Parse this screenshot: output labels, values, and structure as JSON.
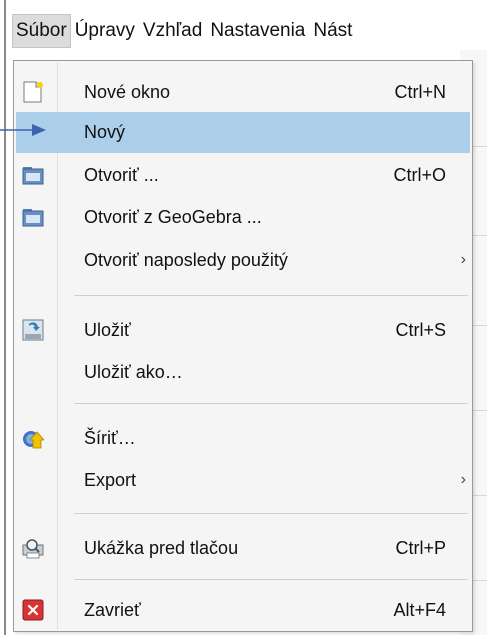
{
  "menubar": {
    "items": [
      {
        "label": "Súbor",
        "active": true
      },
      {
        "label": "Úpravy"
      },
      {
        "label": "Vzhľad"
      },
      {
        "label": "Nastavenia"
      },
      {
        "label": "Nást"
      }
    ]
  },
  "menu": {
    "highlight_color": "#abcfea",
    "items": [
      {
        "label": "Nové okno",
        "shortcut": "Ctrl+N",
        "icon": "new-window-icon"
      },
      {
        "label": "Nový",
        "highlighted": true
      },
      {
        "label": "Otvoriť ...",
        "shortcut": "Ctrl+O",
        "icon": "open-folder-icon"
      },
      {
        "label": "Otvoriť z GeoGebra ...",
        "icon": "open-folder-icon"
      },
      {
        "label": "Otvoriť naposledy použitý",
        "submenu_arrow": "›"
      },
      {
        "label": "Uložiť",
        "shortcut": "Ctrl+S",
        "icon": "save-icon"
      },
      {
        "label": "Uložiť ako…"
      },
      {
        "label": "Šíriť…",
        "icon": "share-icon"
      },
      {
        "label": "Export",
        "submenu_arrow": "›"
      },
      {
        "label": "Ukážka pred tlačou",
        "shortcut": "Ctrl+P",
        "icon": "print-preview-icon"
      },
      {
        "label": "Zavrieť",
        "shortcut": "Alt+F4",
        "icon": "close-icon"
      }
    ]
  }
}
